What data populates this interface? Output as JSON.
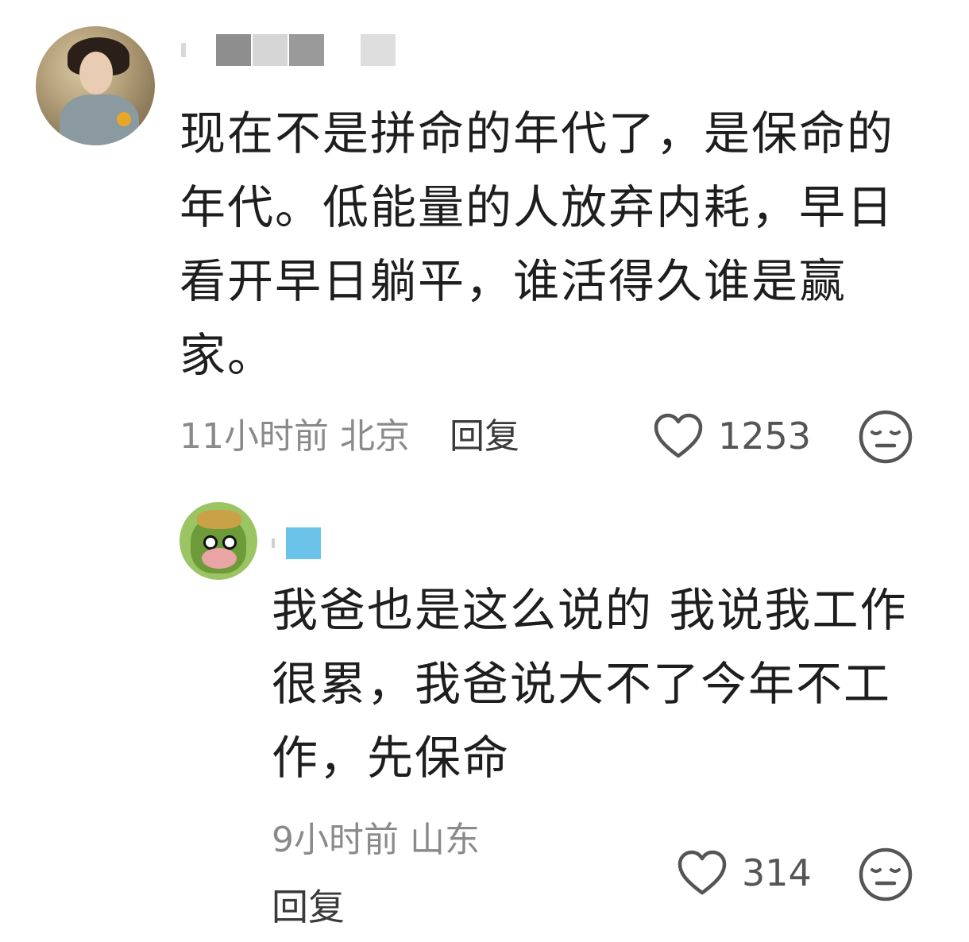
{
  "comments": [
    {
      "username": "",
      "avatar_icon": "user-avatar-photo",
      "text": "现在不是拼命的年代了，是保命的年代。低能量的人放弃内耗，早日看开早日躺平，谁活得久谁是赢家。",
      "time": "11小时前",
      "location": "北京",
      "reply_label": "回复",
      "likes": "1253",
      "like_icon": "heart-outline-icon",
      "reaction_icon": "neutral-face-icon"
    },
    {
      "username": "",
      "avatar_icon": "cow-avatar",
      "text": "我爸也是这么说的 我说我工作很累，我爸说大不了今年不工作，先保命",
      "time": "9小时前",
      "location": "山东",
      "reply_label": "回复",
      "likes": "314",
      "like_icon": "heart-outline-icon",
      "reaction_icon": "neutral-face-icon"
    }
  ],
  "colors": {
    "text": "#1e1e1e",
    "meta": "#8a8a8a",
    "reply": "#3a3a3a",
    "mask_gray": "#9a9a9a",
    "mask_blue": "#6cc3ea"
  }
}
